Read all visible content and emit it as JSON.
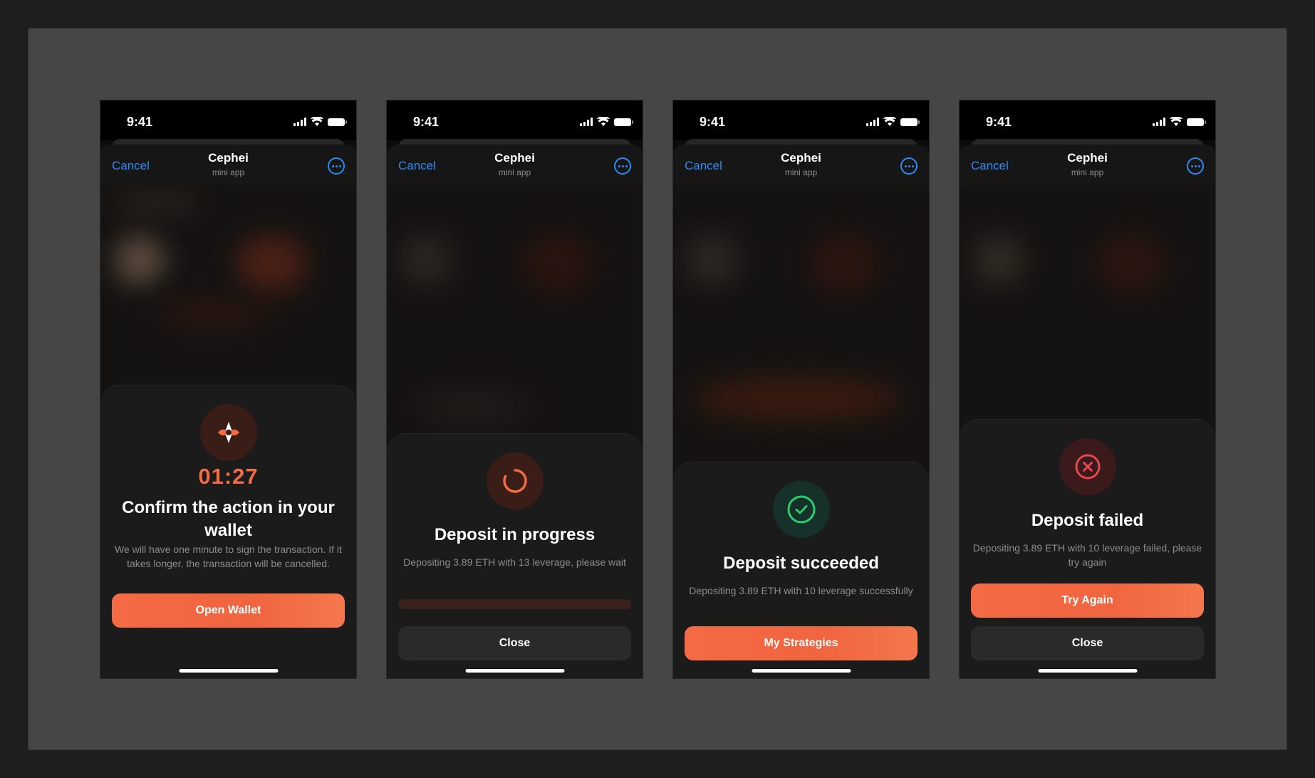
{
  "screens": [
    {
      "status": {
        "time": "9:41"
      },
      "header": {
        "cancel": "Cancel",
        "title": "Cephei",
        "subtitle": "mini app"
      },
      "sheet": {
        "timer": "01:27",
        "title": "Confirm the action in your wallet",
        "description": "We will have one minute to sign the transaction. If it takes longer, the transaction will be cancelled.",
        "primary_button": "Open Wallet"
      }
    },
    {
      "status": {
        "time": "9:41"
      },
      "header": {
        "cancel": "Cancel",
        "title": "Cephei",
        "subtitle": "mini app"
      },
      "sheet": {
        "title": "Deposit in progress",
        "description": "Depositing 3.89 ETH with 13 leverage, please wait",
        "progress": 0,
        "secondary_button": "Close"
      }
    },
    {
      "status": {
        "time": "9:41"
      },
      "header": {
        "cancel": "Cancel",
        "title": "Cephei",
        "subtitle": "mini app"
      },
      "sheet": {
        "title": "Deposit succeeded",
        "description": "Depositing 3.89 ETH with 10 leverage successfully",
        "primary_button": "My Strategies"
      }
    },
    {
      "status": {
        "time": "9:41"
      },
      "header": {
        "cancel": "Cancel",
        "title": "Cephei",
        "subtitle": "mini app"
      },
      "sheet": {
        "title": "Deposit failed",
        "description": "Depositing 3.89 ETH with 10 leverage failed, please try again",
        "primary_button": "Try Again",
        "secondary_button": "Close"
      }
    }
  ],
  "icons": {
    "screen_1": "cephei-logo-icon",
    "screen_2": "spinner-icon",
    "screen_3": "check-circle-icon",
    "screen_4": "x-circle-icon"
  },
  "colors": {
    "accent": "#f26b43",
    "link": "#2f8af5",
    "success": "#2ecc71",
    "error": "#e5484d",
    "canvas": "#464646",
    "sheet": "#1b1b1b"
  }
}
